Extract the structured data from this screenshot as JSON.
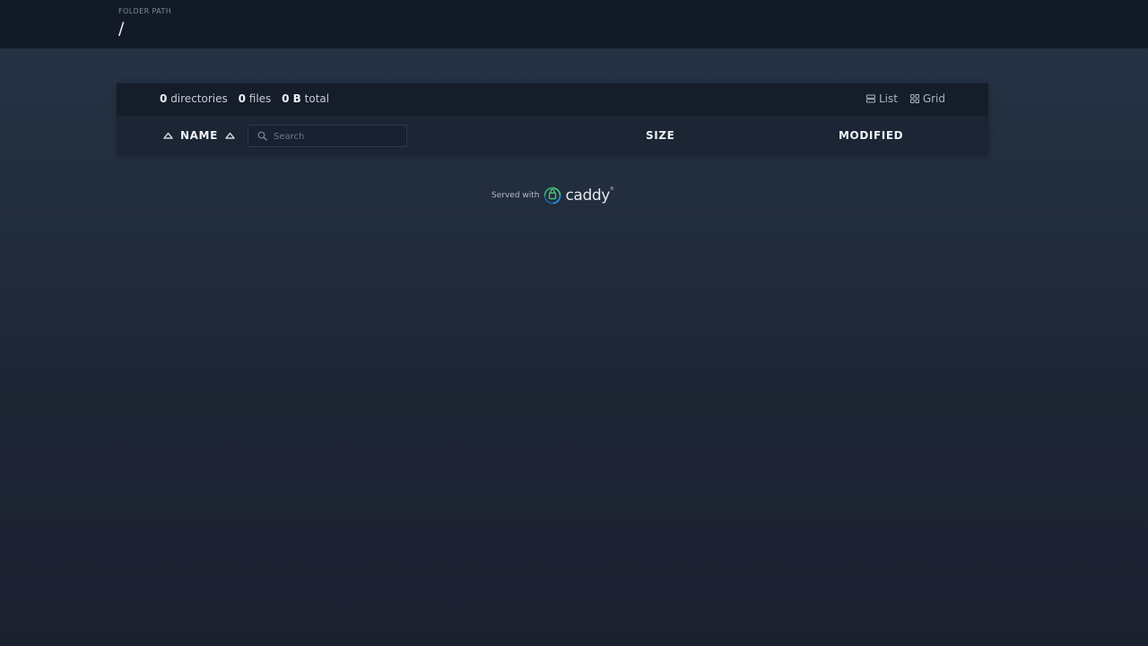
{
  "header": {
    "folder_label": "FOLDER PATH",
    "folder_path": "/"
  },
  "summary": {
    "directories_count": "0",
    "directories_label": "directories",
    "files_count": "0",
    "files_label": "files",
    "total_size": "0 B",
    "total_label": "total"
  },
  "layout": {
    "list_label": "List",
    "grid_label": "Grid"
  },
  "columns": {
    "name": "NAME",
    "size": "SIZE",
    "modified": "MODIFIED"
  },
  "search": {
    "placeholder": "Search",
    "value": ""
  },
  "footer": {
    "served_with": "Served with",
    "brand": "caddy",
    "trademark": "®"
  },
  "colors": {
    "header_bg": "#121a27",
    "panel_bg": "#1a2431",
    "accent_green": "#4ec07a",
    "accent_blue": "#2a8fd6"
  }
}
